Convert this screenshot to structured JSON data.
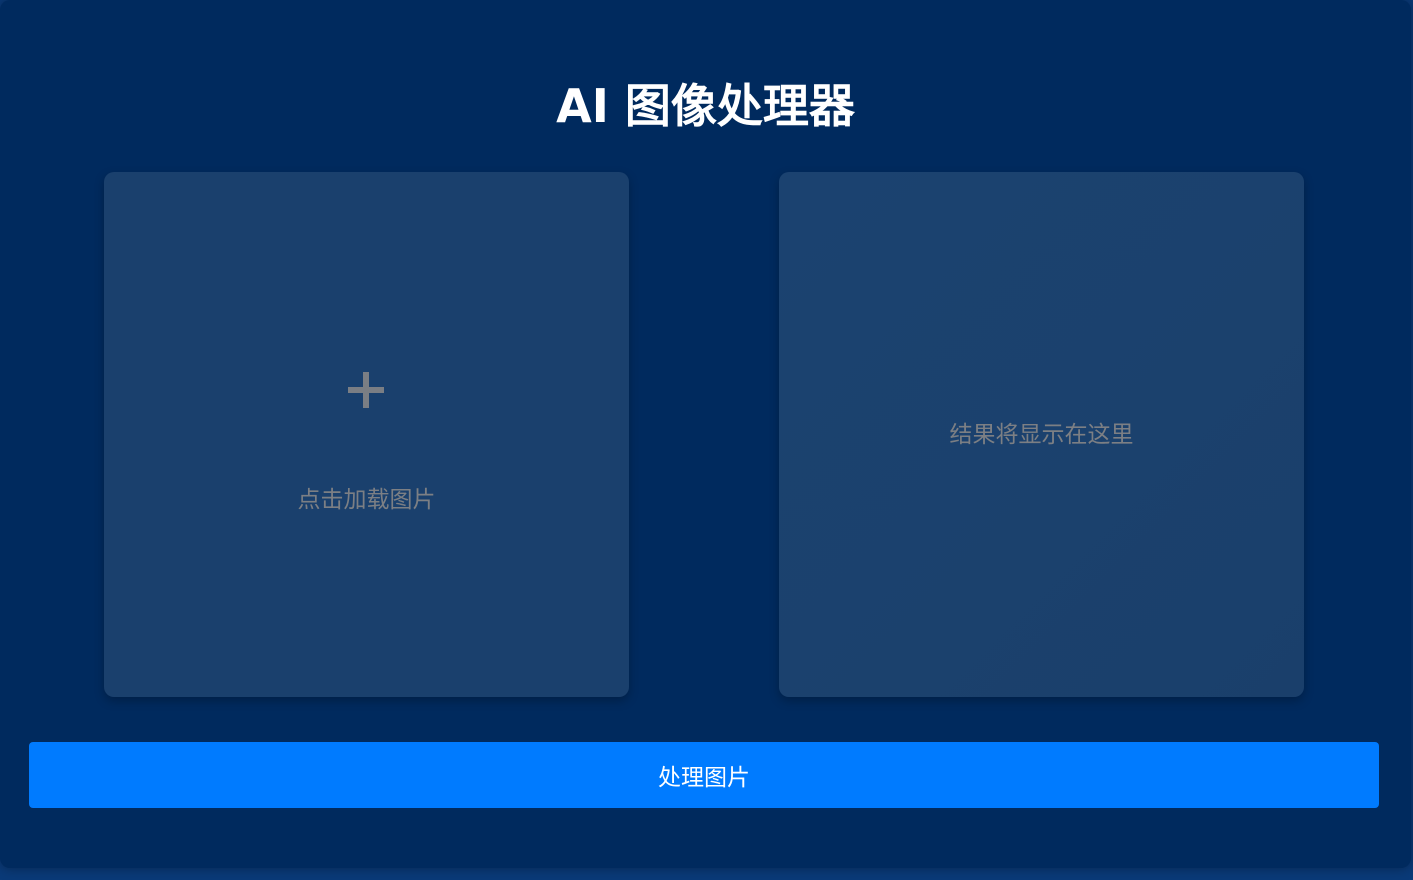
{
  "header": {
    "title": "AI 图像处理器"
  },
  "upload_panel": {
    "icon": "plus-icon",
    "label": "点击加载图片"
  },
  "result_panel": {
    "placeholder": "结果将显示在这里"
  },
  "actions": {
    "process_label": "处理图片"
  },
  "colors": {
    "background": "#002a5e",
    "panel": "#1a406d",
    "accent": "#007bff",
    "muted_text": "#7c7f84"
  }
}
